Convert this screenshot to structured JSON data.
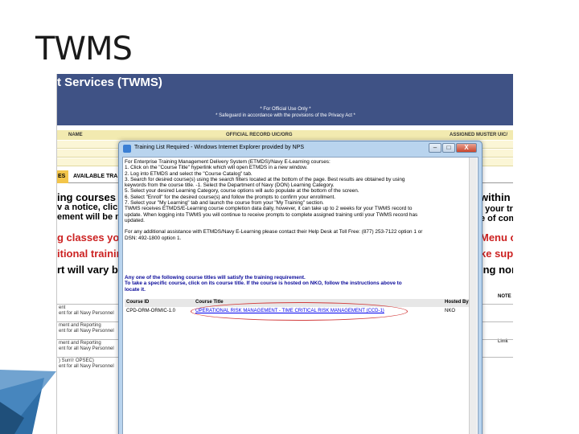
{
  "slide": {
    "title": "TWMS"
  },
  "background_app": {
    "header_title": "t Services (TWMS)",
    "notice_line1": "* For Official Use Only *",
    "notice_line2": "* Safeguard in accordance with the provisions of the Privacy Act *",
    "columns": {
      "name": "NAME",
      "official_record": "OFFICIAL RECORD UIC/ORG",
      "assigned_muster": "ASSIGNED MUSTER UIC/"
    },
    "tabs": {
      "tab_es": "ES",
      "available": "AVAILABLE TRA"
    },
    "left_fragments": [
      "ing courses o",
      "v a notice, click",
      "ement will be ma",
      "g classes you h",
      "itional trainin",
      "rt will vary base"
    ],
    "right_fragments": [
      "within",
      ", your tra",
      "e of comp",
      "Menu on",
      "ke super",
      "ing non p"
    ],
    "left_fragment_colors": [
      "#000000",
      "#000000",
      "#000000",
      "#cc2222",
      "#cc2222",
      "#000000"
    ],
    "right_fragment_colors": [
      "#000000",
      "#000000",
      "#000000",
      "#cc2222",
      "#cc2222",
      "#000000"
    ],
    "table_rows": [
      {
        "a": "ent",
        "b": "ent for all Navy Personnel"
      },
      {
        "a": "ment and Reporting",
        "b": "ent for all Navy Personnel"
      },
      {
        "a": "ment and Reporting",
        "b": "ent for all Navy Personnel"
      },
      {
        "a": ") Sum'r OPSEC)",
        "b": "ent for all Navy Personnel"
      }
    ],
    "right_labels": {
      "note": "NOTE",
      "limit": "Limit"
    }
  },
  "modal": {
    "title": "Training List Required - Windows Internet Explorer provided by NPS",
    "buttons": {
      "minimize": "–",
      "maximize": "□",
      "close": "X"
    },
    "instructions": [
      "For Enterprise Training Management Delivery System (ETMDS)/Navy E-Learning courses:",
      "1. Click on the \"Course Title\" hyperlink which will open ETMDS in a new window.",
      "2. Log into ETMDS and select the \"Course Catalog\" tab.",
      "3. Search for desired course(s) using the search filters located at the bottom of the page. Best results are obtained by using",
      "keywords from the course title. -1. Select the Department of Navy (DON) Learning Category.",
      "5. Select your desired Learning Category, course options will auto populate at the bottom of the screen.",
      "6. Select \"Enroll\" for the desired course(s) and follow the prompts to confirm your enrollment.",
      "7. Select your \"My Learning\" tab and launch the course from your \"My Training\" section.",
      "TWMS receives ETMDS/E-Learning course completion data daily, however, it can take up to 2 weeks for your TWMS record to",
      "update. When logging into TWMS you will continue to receive prompts to complete assigned training until your TWMS record has",
      "updated.",
      "",
      "For any additional assistance with ETMDS/Navy E-Learning please contact their Help Desk at Toll Free: (877) 253-7122 option 1 or",
      "DSN: 492-1800 option 1."
    ],
    "satisfy_text": [
      "Any one of the following course titles will satisfy the training requirement.",
      "To take a specific course, click on its course title. If the course is hosted on NKO, follow the instructions above to",
      "locate it."
    ],
    "course_table": {
      "headers": {
        "course_id": "Course ID",
        "course_title": "Course Title",
        "hosted_by": "Hosted By"
      },
      "rows": [
        {
          "course_id": "CPD-ORM-ORMIC-1.0",
          "course_title": "OPERATIONAL RISK MANAGEMENT - TIME CRITICAL RISK MANAGEMENT (CCD-1)",
          "hosted_by": "NKO"
        }
      ]
    }
  }
}
